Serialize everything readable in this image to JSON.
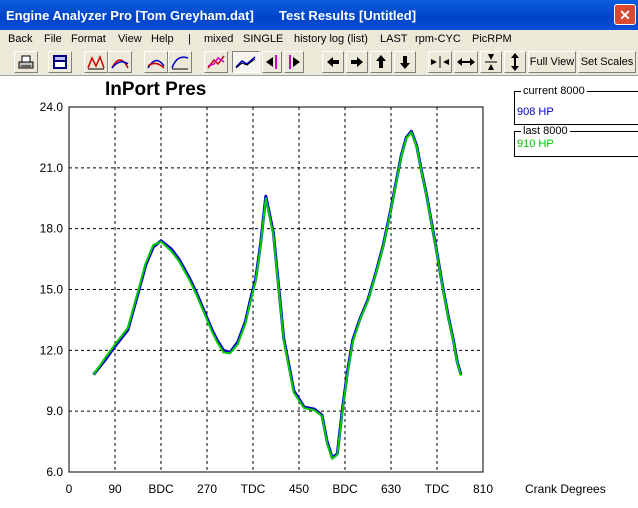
{
  "window": {
    "title": "Engine Analyzer Pro [Tom Greyham.dat]       Test Results [Untitled]",
    "close_glyph": "✕"
  },
  "menu": [
    {
      "label": "Back"
    },
    {
      "label": "File"
    },
    {
      "label": "Format"
    },
    {
      "label": "View"
    },
    {
      "label": "Help"
    },
    {
      "label": "|"
    },
    {
      "label": "mixed"
    },
    {
      "label": "SINGLE"
    },
    {
      "label": "history log (list)"
    },
    {
      "label": "LAST"
    },
    {
      "label": "rpm-CYC"
    },
    {
      "label": "PicRPM"
    }
  ],
  "toolbar": {
    "icons": [
      "print-icon",
      "screen-icon",
      "graph-a-icon",
      "graph-b-icon",
      "graph-c-icon",
      "graph-d-icon",
      "graph-e-icon",
      "overlay-icon",
      "step-left-magenta-icon",
      "step-right-magenta-icon",
      "arrow-left-icon",
      "arrow-right-icon",
      "arrow-up-icon",
      "arrow-down-icon",
      "compress-horizontal-icon",
      "expand-horizontal-icon",
      "compress-vertical-icon",
      "expand-vertical-icon"
    ],
    "full_view_label": "Full View",
    "set_scales_label": "Set Scales"
  },
  "legend": [
    {
      "header": "current  8000",
      "value": "908 HP",
      "color": "#0000cc"
    },
    {
      "header": "last  8000",
      "value": "910 HP",
      "color": "#00cc00"
    }
  ],
  "chart_data": {
    "type": "line",
    "title": "InPort Pres",
    "xlabel": "Crank Degrees",
    "ylim": [
      6.0,
      24.0
    ],
    "xlim": [
      0,
      810
    ],
    "y_ticks": [
      "24.0",
      "21.0",
      "18.0",
      "15.0",
      "12.0",
      "9.0",
      "6.0"
    ],
    "x_ticks": [
      "0",
      "90",
      "BDC",
      "270",
      "TDC",
      "450",
      "BDC",
      "630",
      "TDC",
      "810"
    ],
    "grid": true,
    "series": [
      {
        "name": "current  8000",
        "color": "#0000cc",
        "x": [
          48,
          70,
          90,
          115,
          135,
          150,
          165,
          180,
          200,
          215,
          235,
          250,
          260,
          270,
          280,
          290,
          302,
          315,
          330,
          345,
          355,
          365,
          375,
          385,
          400,
          420,
          440,
          460,
          480,
          495,
          505,
          515,
          525,
          535,
          545,
          555,
          570,
          585,
          600,
          615,
          630,
          640,
          650,
          660,
          670,
          680,
          690,
          700,
          710,
          720,
          730,
          742,
          752,
          760,
          767
        ],
        "y": [
          10.8,
          11.5,
          12.2,
          13.0,
          14.8,
          16.2,
          17.1,
          17.4,
          17.0,
          16.5,
          15.6,
          14.8,
          14.2,
          13.6,
          13.0,
          12.5,
          12.0,
          11.9,
          12.4,
          13.4,
          14.5,
          15.5,
          17.3,
          19.6,
          17.8,
          12.6,
          10.0,
          9.2,
          9.1,
          8.8,
          7.5,
          6.7,
          6.9,
          9.1,
          11.0,
          12.5,
          13.6,
          14.5,
          15.8,
          17.2,
          19.0,
          20.3,
          21.6,
          22.5,
          22.8,
          22.1,
          20.8,
          19.6,
          18.2,
          16.8,
          15.3,
          13.7,
          12.5,
          11.4,
          10.8
        ]
      },
      {
        "name": "last  8000",
        "color": "#00cc00",
        "x": [
          48,
          70,
          90,
          115,
          135,
          150,
          165,
          180,
          200,
          215,
          235,
          250,
          260,
          270,
          280,
          290,
          302,
          315,
          330,
          345,
          355,
          365,
          375,
          385,
          400,
          420,
          440,
          460,
          480,
          495,
          505,
          515,
          525,
          535,
          545,
          555,
          570,
          585,
          600,
          615,
          630,
          640,
          650,
          660,
          670,
          680,
          690,
          700,
          710,
          720,
          730,
          742,
          752,
          760,
          767
        ],
        "y": [
          10.8,
          11.6,
          12.3,
          13.1,
          14.9,
          16.3,
          17.2,
          17.35,
          16.9,
          16.4,
          15.5,
          14.7,
          14.1,
          13.5,
          12.9,
          12.4,
          11.9,
          11.85,
          12.3,
          13.3,
          14.4,
          15.4,
          17.2,
          19.5,
          17.7,
          12.5,
          9.9,
          9.15,
          9.05,
          8.75,
          7.4,
          6.65,
          6.85,
          9.0,
          10.9,
          12.4,
          13.55,
          14.45,
          15.75,
          17.15,
          18.95,
          20.25,
          21.55,
          22.45,
          22.75,
          22.05,
          20.75,
          19.55,
          18.15,
          16.75,
          15.25,
          13.65,
          12.45,
          11.35,
          10.75
        ]
      }
    ]
  }
}
